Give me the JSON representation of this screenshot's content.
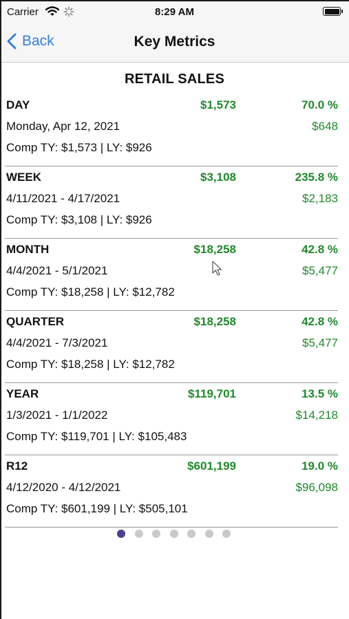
{
  "status_bar": {
    "carrier": "Carrier",
    "time": "8:29 AM",
    "battery_level": 1.0
  },
  "nav": {
    "back_label": "Back",
    "title": "Key Metrics"
  },
  "section_title": "RETAIL SALES",
  "metrics": [
    {
      "period": "DAY",
      "amount": "$1,573",
      "pct": "70.0 %",
      "range": "Monday, Apr 12, 2021",
      "delta": "$648",
      "comp": "Comp TY: $1,573 | LY: $926"
    },
    {
      "period": "WEEK",
      "amount": "$3,108",
      "pct": "235.8 %",
      "range": "4/11/2021 - 4/17/2021",
      "delta": "$2,183",
      "comp": "Comp TY: $3,108 | LY: $926"
    },
    {
      "period": "MONTH",
      "amount": "$18,258",
      "pct": "42.8 %",
      "range": "4/4/2021 - 5/1/2021",
      "delta": "$5,477",
      "comp": "Comp TY: $18,258 | LY: $12,782"
    },
    {
      "period": "QUARTER",
      "amount": "$18,258",
      "pct": "42.8 %",
      "range": "4/4/2021 - 7/3/2021",
      "delta": "$5,477",
      "comp": "Comp TY: $18,258 | LY: $12,782"
    },
    {
      "period": "YEAR",
      "amount": "$119,701",
      "pct": "13.5 %",
      "range": "1/3/2021 - 1/1/2022",
      "delta": "$14,218",
      "comp": "Comp TY: $119,701 | LY: $105,483"
    },
    {
      "period": "R12",
      "amount": "$601,199",
      "pct": "19.0 %",
      "range": "4/12/2020 - 4/12/2021",
      "delta": "$96,098",
      "comp": "Comp TY: $601,199 | LY: $505,101"
    }
  ],
  "pager": {
    "page_count": 7,
    "current_page": 1
  },
  "colors": {
    "accent_blue": "#2f7fd8",
    "positive_green": "#1f8a2a",
    "page_dot_active": "#4b3f8f",
    "page_dot_inactive": "#c9c9c9"
  }
}
